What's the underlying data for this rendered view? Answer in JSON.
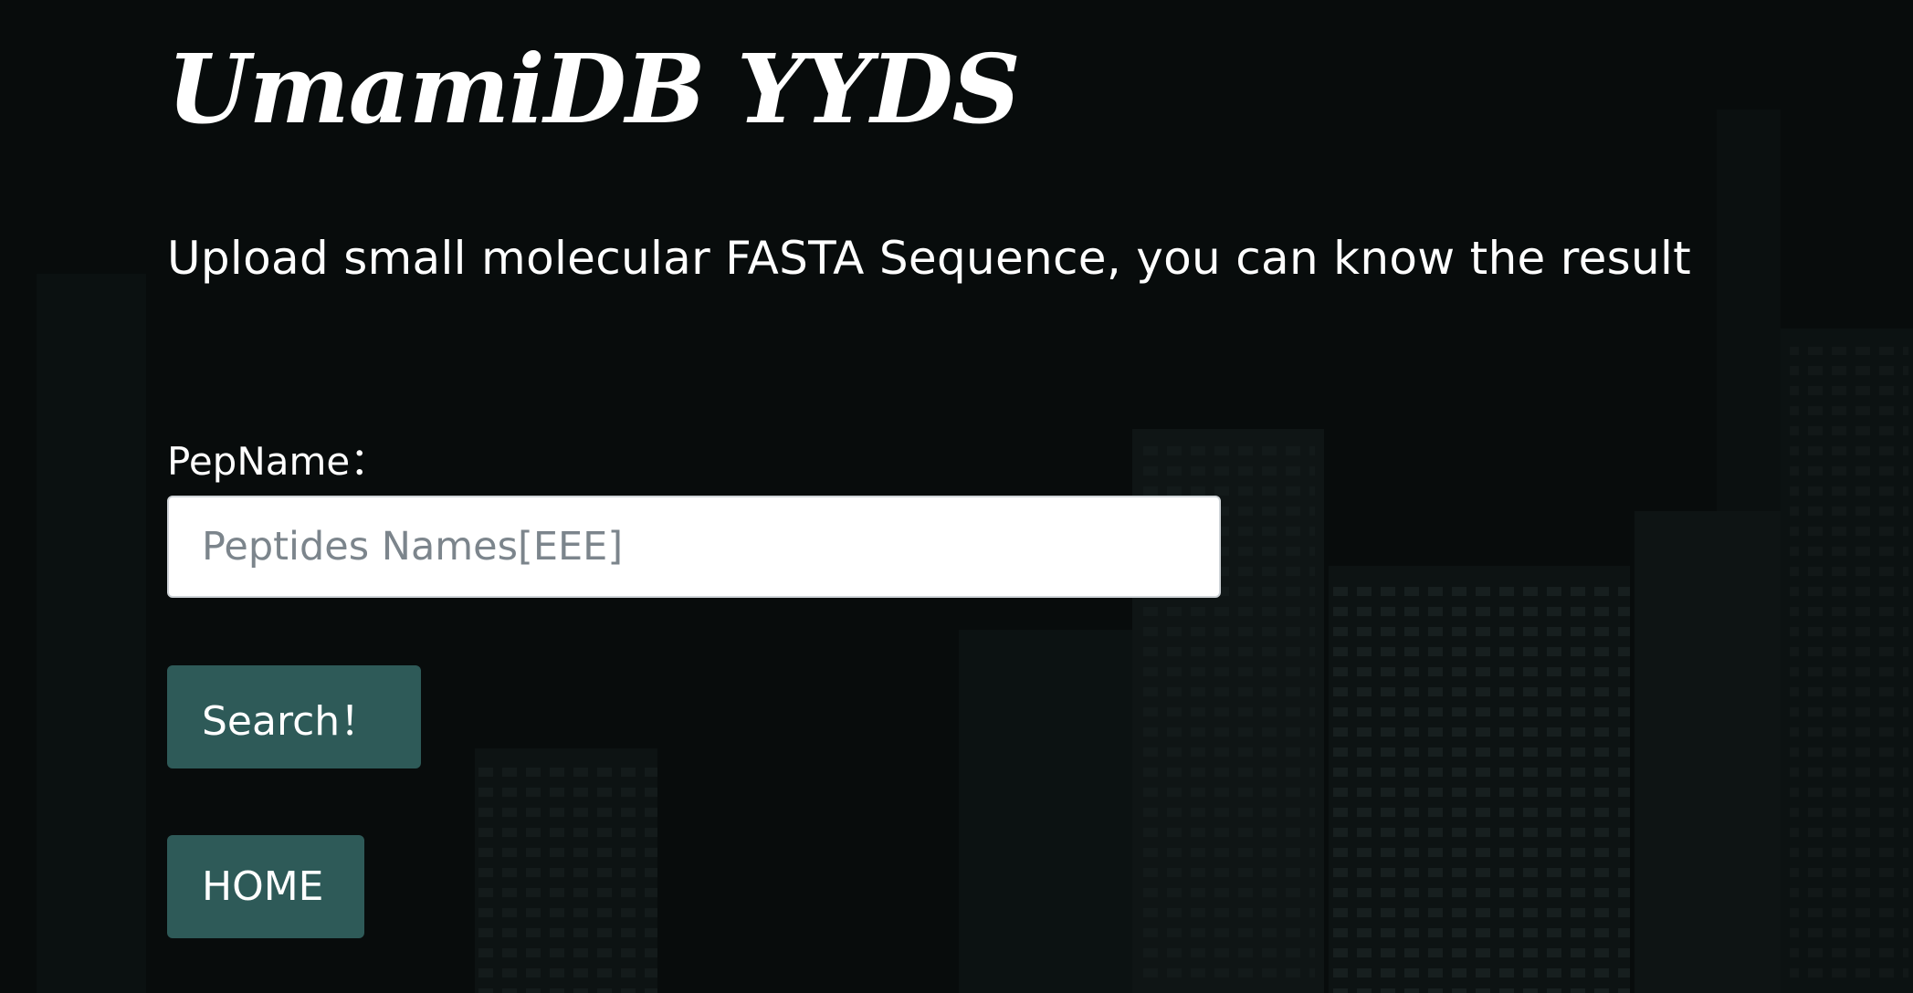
{
  "page": {
    "title": "UmamiDB YYDS",
    "subtitle": "Upload small molecular FASTA Sequence, you can know the result"
  },
  "form": {
    "pepname_label": "PepName：",
    "pepname_placeholder": "Peptides Names[EEE]",
    "pepname_value": "",
    "search_button_label": "Search！"
  },
  "nav": {
    "home_button_label": "HOME"
  },
  "colors": {
    "background": "#080c0c",
    "button_bg": "#2e5a58",
    "text": "#ffffff"
  }
}
